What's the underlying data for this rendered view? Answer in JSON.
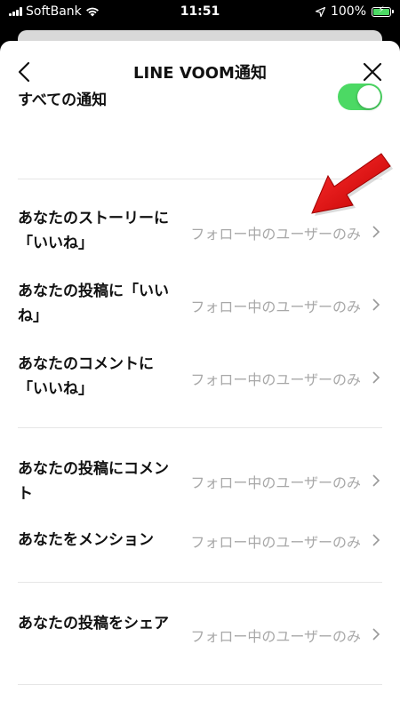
{
  "status_bar": {
    "carrier": "SoftBank",
    "time": "11:51",
    "battery": "100%"
  },
  "header": {
    "title": "LINE VOOM通知"
  },
  "all_notifications": {
    "label": "すべての通知",
    "enabled": true
  },
  "items": [
    {
      "label": "あなたのストーリーに「いいね」",
      "value": "フォロー中のユーザーのみ"
    },
    {
      "label": "あなたの投稿に「いいね」",
      "value": "フォロー中のユーザーのみ"
    },
    {
      "label": "あなたのコメントに「いいね」",
      "value": "フォロー中のユーザーのみ"
    },
    {
      "label": "あなたの投稿にコメント",
      "value": "フォロー中のユーザーのみ"
    },
    {
      "label": "あなたをメンション",
      "value": "フォロー中のユーザーのみ"
    },
    {
      "label": "あなたの投稿をシェア",
      "value": "フォロー中のユーザーのみ"
    }
  ],
  "colors": {
    "toggle_on": "#4cd964",
    "annotation_arrow": "#e00000"
  }
}
